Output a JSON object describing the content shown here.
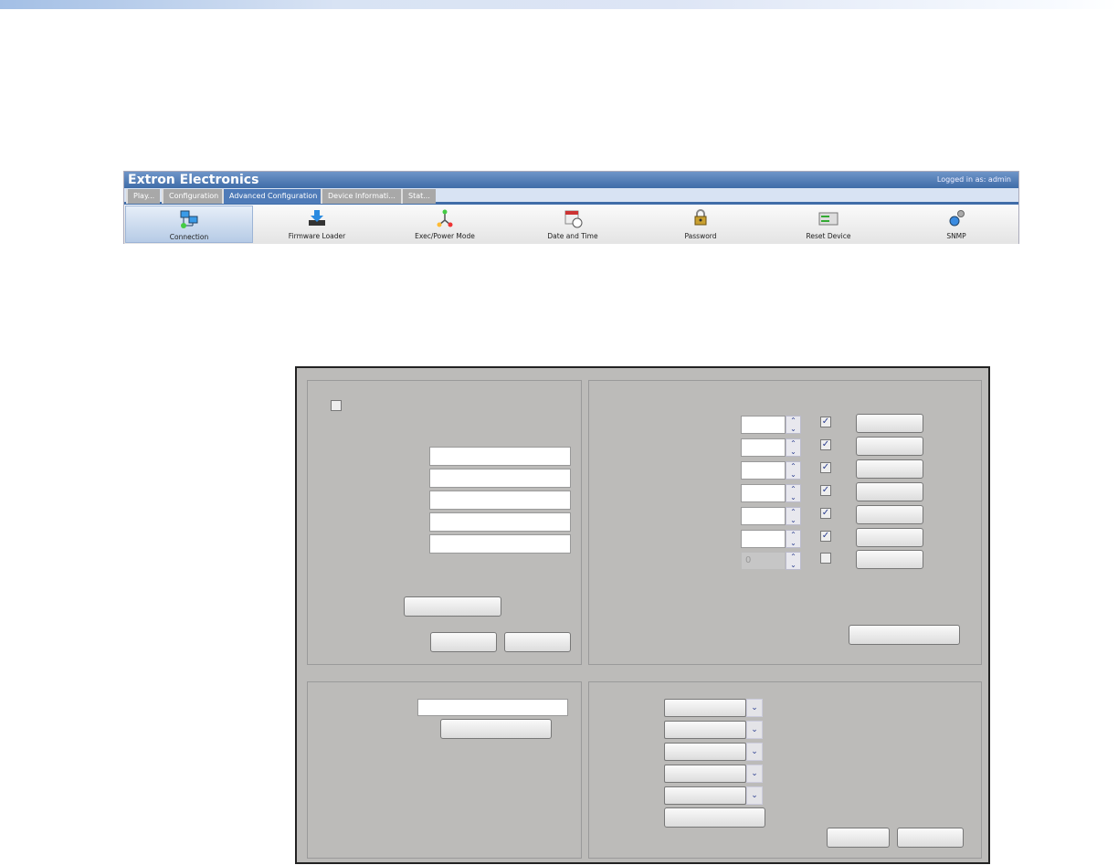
{
  "header": {
    "title": "Extron Electronics",
    "login": "Logged in as: admin"
  },
  "tabs": [
    {
      "label": "Play..."
    },
    {
      "label": "Configuration"
    },
    {
      "label": "Advanced Configuration"
    },
    {
      "label": "Device Informati..."
    },
    {
      "label": "Stat..."
    }
  ],
  "nav": [
    {
      "label": "Connection",
      "icon": "network-icon"
    },
    {
      "label": "Firmware Loader",
      "icon": "firmware-download-icon"
    },
    {
      "label": "Exec/Power Mode",
      "icon": "power-mode-icon"
    },
    {
      "label": "Date and Time",
      "icon": "calendar-clock-icon"
    },
    {
      "label": "Password",
      "icon": "padlock-icon"
    },
    {
      "label": "Reset Device",
      "icon": "reset-device-icon"
    },
    {
      "label": "SNMP",
      "icon": "gears-icon"
    }
  ],
  "ports": {
    "disabled_value": "0"
  },
  "colors": {
    "header": "#3f6ca8",
    "panel": "#bcbbb9",
    "check": "#2a3d8f"
  }
}
